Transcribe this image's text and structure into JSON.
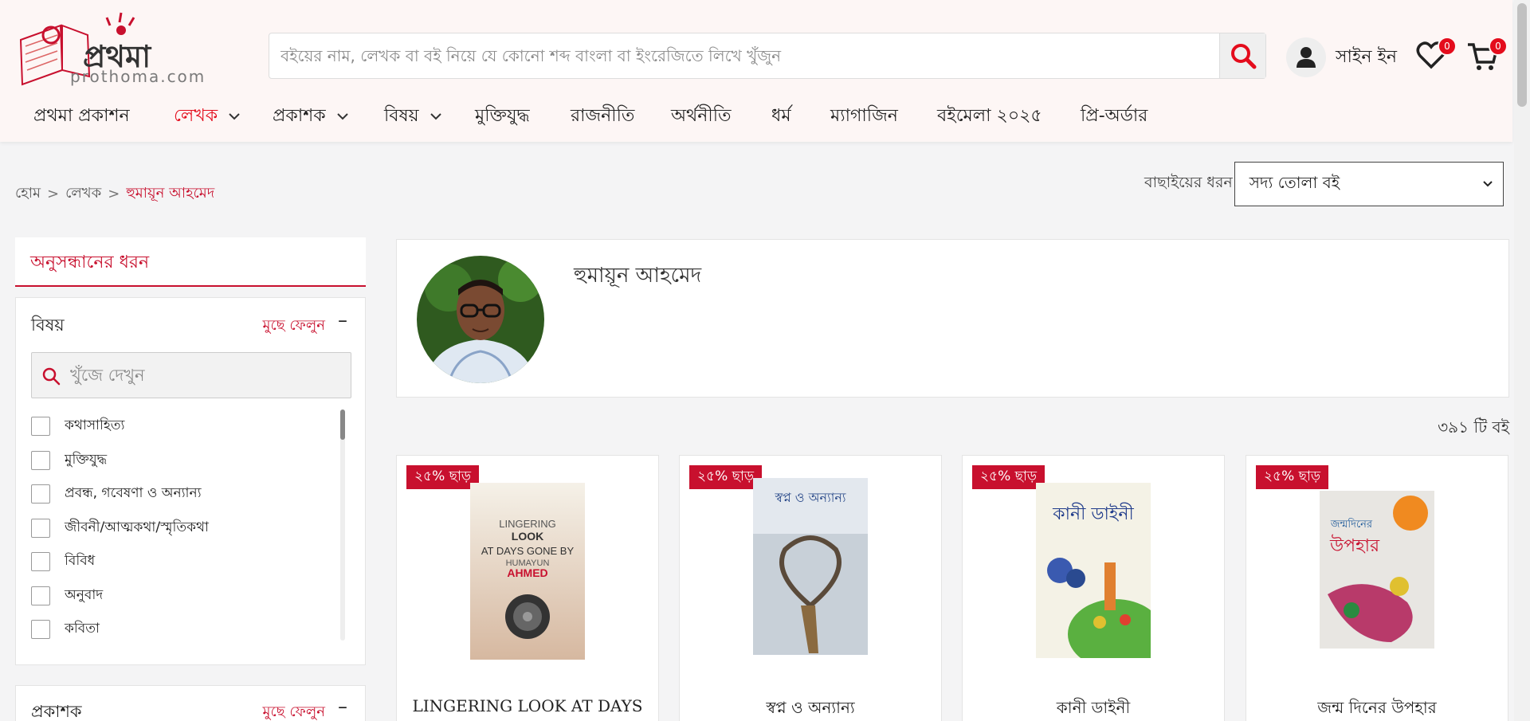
{
  "header": {
    "logo_text": "প্রথমা",
    "logo_subtext": "prothoma.com",
    "search_placeholder": "বইয়ের নাম, লেখক বা বই নিয়ে যে কোনো শব্দ বাংলা বা ইংরেজিতে লিখে খুঁজুন",
    "signin_label": "সাইন ইন",
    "wishlist_count": "0",
    "cart_count": "0",
    "accent_color": "#e40c1c"
  },
  "nav": {
    "items": [
      {
        "label": "প্রথমা প্রকাশন"
      },
      {
        "label": "লেখক"
      },
      {
        "label": "প্রকাশক"
      },
      {
        "label": "বিষয়"
      },
      {
        "label": "মুক্তিযুদ্ধ"
      },
      {
        "label": "রাজনীতি"
      },
      {
        "label": "অর্থনীতি"
      },
      {
        "label": "ধর্ম"
      },
      {
        "label": "ম্যাগাজিন"
      },
      {
        "label": "বইমেলা ২০২৫"
      },
      {
        "label": "প্রি-অর্ডার"
      }
    ]
  },
  "breadcrumb": {
    "home": "হোম",
    "section": "লেখক",
    "current": "হুমায়ূন আহমেদ",
    "separator": ">"
  },
  "sort": {
    "label": "বাছাইয়ের ধরন",
    "selected": "সদ্য তোলা বই"
  },
  "sidebar": {
    "heading": "অনুসন্ধানের ধরন",
    "subject_filter": {
      "title": "বিষয়",
      "clear_label": "মুছে ফেলুন",
      "collapse_symbol": "–",
      "search_placeholder": "খুঁজে দেখুন",
      "options": [
        {
          "label": "কথাসাহিত্য"
        },
        {
          "label": "মুক্তিযুদ্ধ"
        },
        {
          "label": "প্রবন্ধ, গবেষণা ও অন্যান্য"
        },
        {
          "label": "জীবনী/আত্মকথা/স্মৃতিকথা"
        },
        {
          "label": "বিবিধ"
        },
        {
          "label": "অনুবাদ"
        },
        {
          "label": "কবিতা"
        }
      ]
    },
    "publisher_filter": {
      "title": "প্রকাশক",
      "clear_label": "মুছে ফেলুন",
      "collapse_symbol": "–"
    }
  },
  "author": {
    "name": "হুমায়ূন আহমেদ"
  },
  "results": {
    "count_label": "৩৯১ টি বই"
  },
  "products": [
    {
      "discount": "২৫% ছাড়",
      "title": "LINGERING LOOK AT DAYS",
      "cover_text": "LINGERING LOOK AT DAYS GONE BY HUMAYUN AHMED"
    },
    {
      "discount": "২৫% ছাড়",
      "title": "স্বপ্ন ও অন্যান্য",
      "cover_text": "স্বপ্ন ও অন্যান্য"
    },
    {
      "discount": "২৫% ছাড়",
      "title": "কানী ডাইনী",
      "cover_text": "কানী ডাইনী"
    },
    {
      "discount": "২৫% ছাড়",
      "title": "জন্ম দিনের উপহার",
      "cover_text": "জন্মদিনের উপহার"
    }
  ]
}
